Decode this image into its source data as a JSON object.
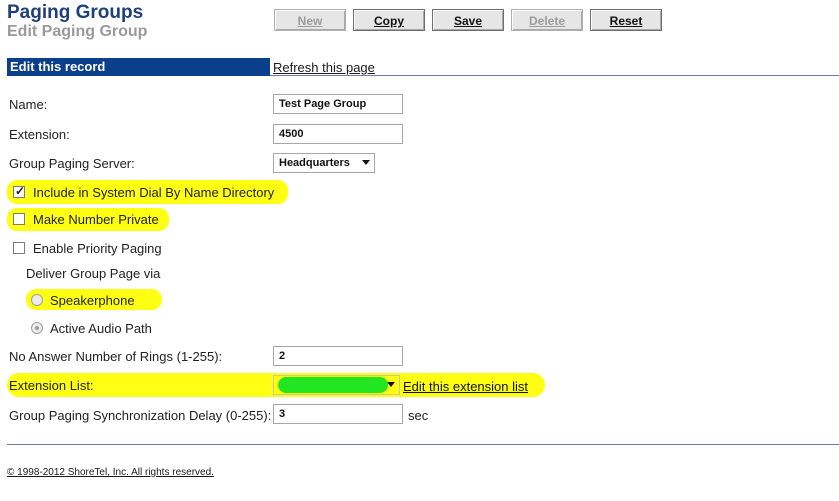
{
  "page": {
    "title": "Paging Groups",
    "subtitle": "Edit Paging Group"
  },
  "toolbar": {
    "new_label": "New",
    "copy_label": "Copy",
    "save_label": "Save",
    "delete_label": "Delete",
    "reset_label": "Reset"
  },
  "section": {
    "header": "Edit this record",
    "refresh_link": "Refresh this page"
  },
  "form": {
    "name": {
      "label": "Name:",
      "value": "Test Page Group"
    },
    "extension": {
      "label": "Extension:",
      "value": "4500"
    },
    "server": {
      "label": "Group Paging Server:",
      "value": "Headquarters"
    },
    "include_dial_by_name": {
      "label": "Include in System Dial By Name Directory",
      "checked": true
    },
    "make_private": {
      "label": "Make Number Private",
      "checked": false
    },
    "priority_paging": {
      "label": "Enable Priority Paging",
      "checked": false
    },
    "deliver_via": {
      "label": "Deliver Group Page via",
      "options": [
        {
          "label": "Speakerphone",
          "selected": false
        },
        {
          "label": "Active Audio Path",
          "selected": true
        }
      ]
    },
    "no_answer_rings": {
      "label": "No Answer Number of Rings (1-255):",
      "value": "2"
    },
    "extension_list": {
      "label": "Extension List:",
      "edit_link": "Edit this extension list"
    },
    "sync_delay": {
      "label": "Group Paging Synchronization Delay (0-255):",
      "value": "3",
      "unit": "sec"
    }
  },
  "footer": {
    "copyright": "© 1998-2012 ShoreTel, Inc. All rights reserved."
  },
  "colors": {
    "header_bar": "#0a3f8c",
    "title": "#1f3f7a",
    "highlight": "#ffff14",
    "redaction": "#22e622"
  },
  "icons": {
    "checkbox_checked": "checkmark-icon",
    "dropdown_arrow": "chevron-down-icon",
    "radio": "radio-icon"
  }
}
